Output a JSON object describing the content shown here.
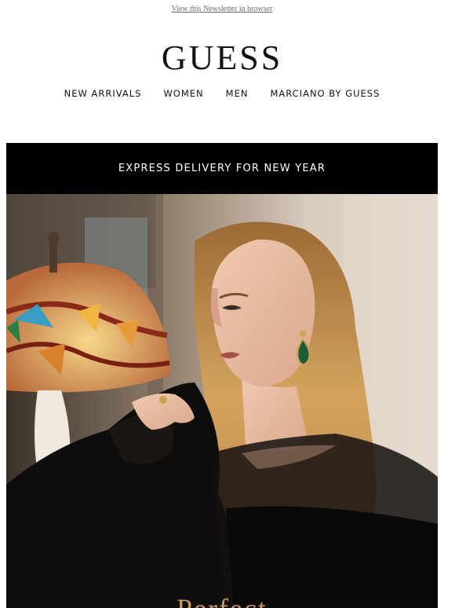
{
  "header": {
    "browser_link": "View this Newsletter in browser",
    "logo_text": "GUESS"
  },
  "nav": {
    "items": [
      {
        "label": "NEW ARRIVALS"
      },
      {
        "label": "WOMEN"
      },
      {
        "label": "MEN"
      },
      {
        "label": "MARCIANO BY GUESS"
      }
    ]
  },
  "banner": {
    "text": "EXPRESS DELIVERY FOR NEW YEAR"
  },
  "hero": {
    "headline_partial": "Perfect",
    "image_description_icon": "hero-photo"
  },
  "colors": {
    "banner_bg": "#000000",
    "headline": "#c79a5a"
  }
}
